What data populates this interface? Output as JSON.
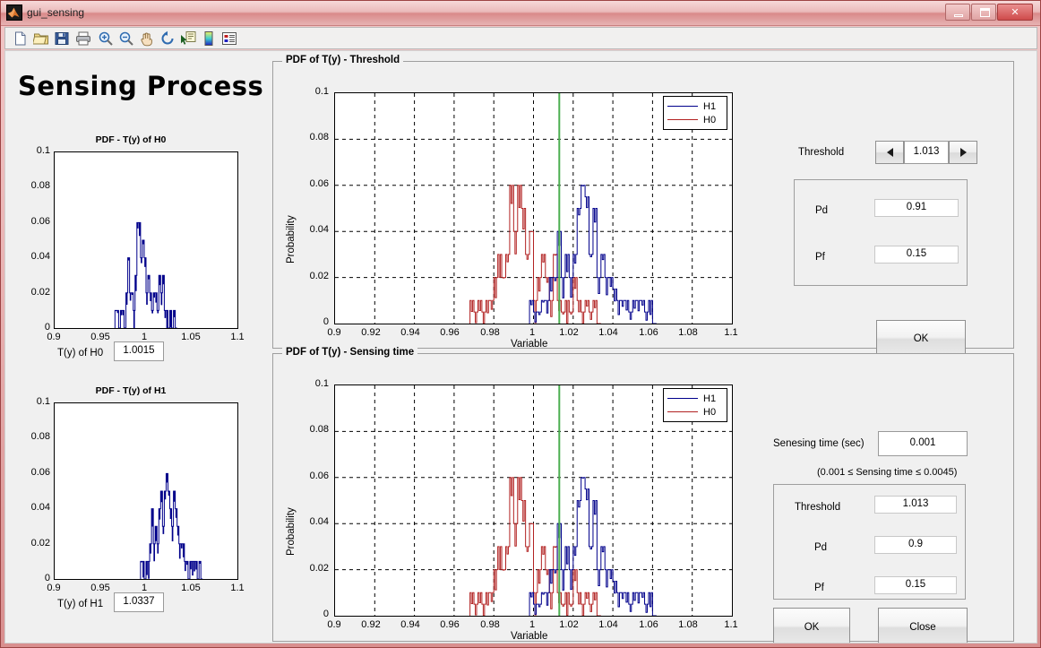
{
  "window": {
    "title": "gui_sensing",
    "icon": "matlab-icon",
    "buttons": {
      "minimize": "minimize-button",
      "maximize": "maximize-button",
      "close_label": "✕"
    }
  },
  "toolbar": {
    "items": [
      {
        "name": "new-file-icon"
      },
      {
        "name": "open-folder-icon"
      },
      {
        "name": "save-icon"
      },
      {
        "name": "print-icon"
      },
      {
        "name": "zoom-in-icon"
      },
      {
        "name": "zoom-out-icon"
      },
      {
        "name": "pan-hand-icon"
      },
      {
        "name": "rotate-3d-icon"
      },
      {
        "name": "data-cursor-icon"
      },
      {
        "name": "colorbar-icon"
      },
      {
        "name": "legend-icon"
      }
    ]
  },
  "app": {
    "title": "Sensing Process"
  },
  "left": {
    "h0": {
      "readout_label": "T(y) of H0",
      "readout_value": "1.0015"
    },
    "h1": {
      "readout_label": "T(y) of H1",
      "readout_value": "1.0337"
    }
  },
  "panels": {
    "threshold_panel_title": "PDF of T(y) - Threshold",
    "sensing_panel_title": "PDF of T(y) - Sensing time"
  },
  "threshold_controls": {
    "threshold_label": "Threshold",
    "threshold_value": "1.013",
    "spin_down": "◀",
    "spin_up": "▶",
    "pd_label": "Pd",
    "pd_value": "0.91",
    "pf_label": "Pf",
    "pf_value": "0.15",
    "ok_label": "OK"
  },
  "sensing_controls": {
    "time_label": "Senesing time (sec)",
    "time_value": "0.001",
    "range_note": "(0.001  ≤ Sensing time  ≤ 0.0045)",
    "threshold_label": "Threshold",
    "threshold_value": "1.013",
    "pd_label": "Pd",
    "pd_value": "0.9",
    "pf_label": "Pf",
    "pf_value": "0.15",
    "ok_label": "OK",
    "close_label": "Close"
  },
  "colors": {
    "h1": "#00008b",
    "h0": "#b22222",
    "threshold_line": "#4caf50",
    "panel_bg": "#f0f0f0",
    "axes_bg": "#ffffff",
    "title_bar": "#e0a3a3"
  },
  "chart_data": [
    {
      "id": "pdf-h0-small",
      "type": "line",
      "title": "PDF - T(y) of H0",
      "xlabel": "",
      "ylabel": "",
      "xlim": [
        0.9,
        1.1
      ],
      "ylim": [
        0,
        0.1
      ],
      "xticks": [
        "0.9",
        "0.95",
        "1",
        "1.05",
        "1.1"
      ],
      "yticks": [
        "0",
        "0.02",
        "0.04",
        "0.06",
        "0.08",
        "0.1"
      ],
      "grid": false,
      "legend": "none",
      "series": [
        {
          "name": "H0",
          "color": "#00008b",
          "x": [
            0.967,
            0.969,
            0.971,
            0.973,
            0.975,
            0.977,
            0.979,
            0.981,
            0.983,
            0.985,
            0.987,
            0.989,
            0.991,
            0.993,
            0.995,
            0.997,
            0.999,
            1.001,
            1.003,
            1.005,
            1.007,
            1.009,
            1.011,
            1.013,
            1.015,
            1.017,
            1.019,
            1.021,
            1.023,
            1.025,
            1.027,
            1.029,
            1.031,
            1.033
          ],
          "values": [
            0.01,
            0.01,
            0.0,
            0.01,
            0.01,
            0.0,
            0.02,
            0.04,
            0.02,
            0.02,
            0.01,
            0.03,
            0.06,
            0.06,
            0.04,
            0.05,
            0.04,
            0.02,
            0.03,
            0.02,
            0.01,
            0.02,
            0.02,
            0.01,
            0.03,
            0.02,
            0.03,
            0.01,
            0.01,
            0.0,
            0.01,
            0.0,
            0.01,
            0.0
          ]
        }
      ]
    },
    {
      "id": "pdf-h1-small",
      "type": "line",
      "title": "PDF - T(y) of H1",
      "xlabel": "",
      "ylabel": "",
      "xlim": [
        0.9,
        1.1
      ],
      "ylim": [
        0,
        0.1
      ],
      "xticks": [
        "0.9",
        "0.95",
        "1",
        "1.05",
        "1.1"
      ],
      "yticks": [
        "0",
        "0.02",
        "0.04",
        "0.06",
        "0.08",
        "0.1"
      ],
      "grid": false,
      "legend": "none",
      "series": [
        {
          "name": "H1",
          "color": "#00008b",
          "x": [
            0.995,
            0.997,
            0.999,
            1.001,
            1.003,
            1.005,
            1.007,
            1.009,
            1.011,
            1.013,
            1.015,
            1.017,
            1.019,
            1.021,
            1.023,
            1.025,
            1.027,
            1.029,
            1.031,
            1.033,
            1.035,
            1.037,
            1.039,
            1.041,
            1.043,
            1.045,
            1.047,
            1.049,
            1.051,
            1.053,
            1.055,
            1.057,
            1.059,
            1.061
          ],
          "values": [
            0.01,
            0.01,
            0.0,
            0.01,
            0.01,
            0.02,
            0.04,
            0.02,
            0.03,
            0.02,
            0.04,
            0.05,
            0.03,
            0.05,
            0.06,
            0.05,
            0.04,
            0.03,
            0.05,
            0.04,
            0.03,
            0.02,
            0.02,
            0.02,
            0.01,
            0.01,
            0.0,
            0.01,
            0.01,
            0.01,
            0.01,
            0.0,
            0.01,
            0.0
          ]
        }
      ]
    },
    {
      "id": "pdf-threshold-main",
      "type": "line",
      "title": "PDF of T(y) - Threshold",
      "xlabel": "Variable",
      "ylabel": "Probability",
      "xlim": [
        0.9,
        1.1
      ],
      "ylim": [
        0,
        0.1
      ],
      "xticks": [
        "0.9",
        "0.92",
        "0.94",
        "0.96",
        "0.98",
        "1",
        "1.02",
        "1.04",
        "1.06",
        "1.08",
        "1.1"
      ],
      "yticks": [
        "0",
        "0.02",
        "0.04",
        "0.06",
        "0.08",
        "0.1"
      ],
      "grid": true,
      "legend": "upper right",
      "threshold_marker": 1.013,
      "series": [
        {
          "name": "H0",
          "color": "#b22222",
          "x": [
            0.969,
            0.971,
            0.973,
            0.975,
            0.977,
            0.979,
            0.981,
            0.983,
            0.985,
            0.987,
            0.989,
            0.991,
            0.993,
            0.995,
            0.997,
            0.999,
            1.001,
            1.003,
            1.005,
            1.007,
            1.009,
            1.011,
            1.013,
            1.015,
            1.017,
            1.019,
            1.021,
            1.023,
            1.025,
            1.027,
            1.029,
            1.031,
            1.033
          ],
          "values": [
            0.01,
            0.005,
            0.01,
            0.005,
            0.01,
            0.01,
            0.02,
            0.03,
            0.02,
            0.03,
            0.06,
            0.04,
            0.06,
            0.05,
            0.03,
            0.04,
            0.01,
            0.02,
            0.03,
            0.02,
            0.01,
            0.03,
            0.01,
            0.005,
            0.01,
            0.005,
            0.02,
            0.01,
            0.005,
            0.01,
            0.005,
            0.01,
            0.0
          ]
        },
        {
          "name": "H1",
          "color": "#00008b",
          "x": [
            0.999,
            1.001,
            1.003,
            1.005,
            1.007,
            1.009,
            1.011,
            1.013,
            1.015,
            1.017,
            1.019,
            1.021,
            1.023,
            1.025,
            1.027,
            1.029,
            1.031,
            1.033,
            1.035,
            1.037,
            1.039,
            1.041,
            1.043,
            1.045,
            1.047,
            1.049,
            1.051,
            1.053,
            1.055,
            1.057,
            1.059,
            1.061
          ],
          "values": [
            0.01,
            0.005,
            0.005,
            0.01,
            0.01,
            0.02,
            0.02,
            0.04,
            0.02,
            0.03,
            0.02,
            0.03,
            0.05,
            0.06,
            0.055,
            0.03,
            0.05,
            0.02,
            0.03,
            0.02,
            0.02,
            0.015,
            0.01,
            0.01,
            0.01,
            0.005,
            0.01,
            0.01,
            0.01,
            0.005,
            0.01,
            0.0
          ]
        }
      ]
    },
    {
      "id": "pdf-sensing-main",
      "type": "line",
      "title": "PDF of T(y) - Sensing time",
      "xlabel": "Variable",
      "ylabel": "Probability",
      "xlim": [
        0.9,
        1.1
      ],
      "ylim": [
        0,
        0.1
      ],
      "xticks": [
        "0.9",
        "0.92",
        "0.94",
        "0.96",
        "0.98",
        "1",
        "1.02",
        "1.04",
        "1.06",
        "1.08",
        "1.1"
      ],
      "yticks": [
        "0",
        "0.02",
        "0.04",
        "0.06",
        "0.08",
        "0.1"
      ],
      "grid": true,
      "legend": "upper right",
      "threshold_marker": 1.013,
      "series": [
        {
          "name": "H0",
          "color": "#b22222",
          "x": [
            0.969,
            0.971,
            0.973,
            0.975,
            0.977,
            0.979,
            0.981,
            0.983,
            0.985,
            0.987,
            0.989,
            0.991,
            0.993,
            0.995,
            0.997,
            0.999,
            1.001,
            1.003,
            1.005,
            1.007,
            1.009,
            1.011,
            1.013,
            1.015,
            1.017,
            1.019,
            1.021,
            1.023,
            1.025,
            1.027,
            1.029,
            1.031,
            1.033
          ],
          "values": [
            0.01,
            0.005,
            0.01,
            0.005,
            0.01,
            0.01,
            0.02,
            0.03,
            0.02,
            0.03,
            0.06,
            0.04,
            0.06,
            0.05,
            0.03,
            0.04,
            0.01,
            0.02,
            0.03,
            0.02,
            0.01,
            0.03,
            0.01,
            0.005,
            0.01,
            0.005,
            0.02,
            0.01,
            0.005,
            0.01,
            0.005,
            0.01,
            0.0
          ]
        },
        {
          "name": "H1",
          "color": "#00008b",
          "x": [
            0.999,
            1.001,
            1.003,
            1.005,
            1.007,
            1.009,
            1.011,
            1.013,
            1.015,
            1.017,
            1.019,
            1.021,
            1.023,
            1.025,
            1.027,
            1.029,
            1.031,
            1.033,
            1.035,
            1.037,
            1.039,
            1.041,
            1.043,
            1.045,
            1.047,
            1.049,
            1.051,
            1.053,
            1.055,
            1.057,
            1.059,
            1.061
          ],
          "values": [
            0.01,
            0.005,
            0.005,
            0.01,
            0.01,
            0.02,
            0.02,
            0.04,
            0.02,
            0.03,
            0.02,
            0.03,
            0.05,
            0.06,
            0.055,
            0.03,
            0.05,
            0.02,
            0.03,
            0.02,
            0.02,
            0.015,
            0.01,
            0.01,
            0.01,
            0.005,
            0.01,
            0.01,
            0.01,
            0.005,
            0.01,
            0.0
          ]
        }
      ]
    }
  ]
}
